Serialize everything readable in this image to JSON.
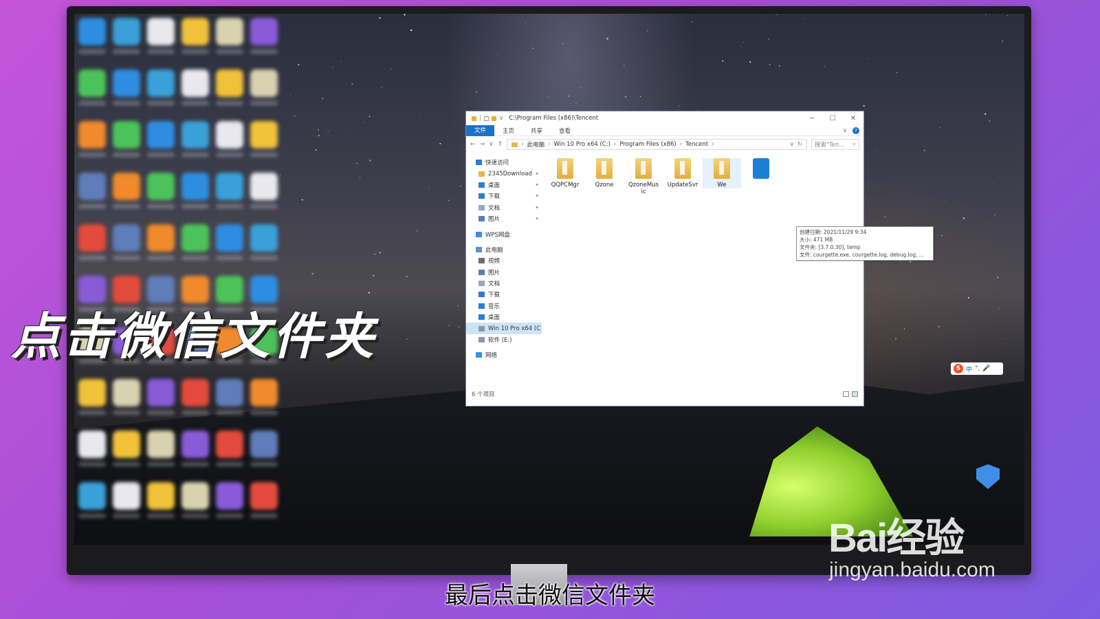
{
  "explorer": {
    "title_path": "C:\\Program Files (x86)\\Tencent",
    "ribbon_tabs": [
      "文件",
      "主页",
      "共享",
      "查看"
    ],
    "breadcrumb": [
      "此电脑",
      "Win 10 Pro x64 (C:)",
      "Program Files (x86)",
      "Tencent"
    ],
    "search_placeholder": "搜索\"Ten...",
    "nav_items": [
      {
        "label": "快速访问",
        "icon": "star-icon",
        "root": true
      },
      {
        "label": "2345Download",
        "icon": "folder-icon",
        "pinned": true
      },
      {
        "label": "桌面",
        "icon": "desktop-icon",
        "pinned": true
      },
      {
        "label": "下载",
        "icon": "download-icon",
        "pinned": true
      },
      {
        "label": "文档",
        "icon": "document-icon",
        "pinned": true
      },
      {
        "label": "图片",
        "icon": "picture-icon",
        "pinned": true
      },
      {
        "label": "WPS网盘",
        "icon": "cloud-icon",
        "root": true
      },
      {
        "label": "此电脑",
        "icon": "computer-icon",
        "root": true
      },
      {
        "label": "视频",
        "icon": "video-icon"
      },
      {
        "label": "图片",
        "icon": "picture-icon"
      },
      {
        "label": "文档",
        "icon": "document-icon"
      },
      {
        "label": "下载",
        "icon": "download-icon"
      },
      {
        "label": "音乐",
        "icon": "music-icon"
      },
      {
        "label": "桌面",
        "icon": "desktop-icon"
      },
      {
        "label": "Win 10 Pro x64 (C",
        "icon": "drive-icon",
        "selected": true
      },
      {
        "label": "软件 (E:)",
        "icon": "drive-icon"
      },
      {
        "label": "网络",
        "icon": "network-icon",
        "root": true
      }
    ],
    "files": [
      {
        "name": "QQPCMgr",
        "type": "folder"
      },
      {
        "name": "Qzone",
        "type": "folder"
      },
      {
        "name": "QzoneMus\nic",
        "type": "folder"
      },
      {
        "name": "UpdateSvr",
        "type": "folder"
      },
      {
        "name": "We",
        "type": "folder"
      },
      {
        "name": "",
        "type": "app"
      }
    ],
    "tooltip": {
      "line1": "创建日期: 2021/11/29 9:34",
      "line2": "大小: 471 MB",
      "line3": "文件夹: [3.7.0.30], temp",
      "line4": "文件: courgette.exe, courgette.log, debug.log, ..."
    },
    "status_count": "6 个项目"
  },
  "ime": {
    "lang": "中",
    "punct": "°,"
  },
  "overlay": {
    "headline": "点击微信文件夹",
    "subtitle": "最后点击微信文件夹",
    "watermark_brand": "Bai经验",
    "watermark_url": "jingyan.baidu.com"
  },
  "colors": {
    "accent": "#1a73c8",
    "folder": "#e8b84a",
    "background_left": "#c455d8",
    "background_right": "#7d5be0"
  }
}
